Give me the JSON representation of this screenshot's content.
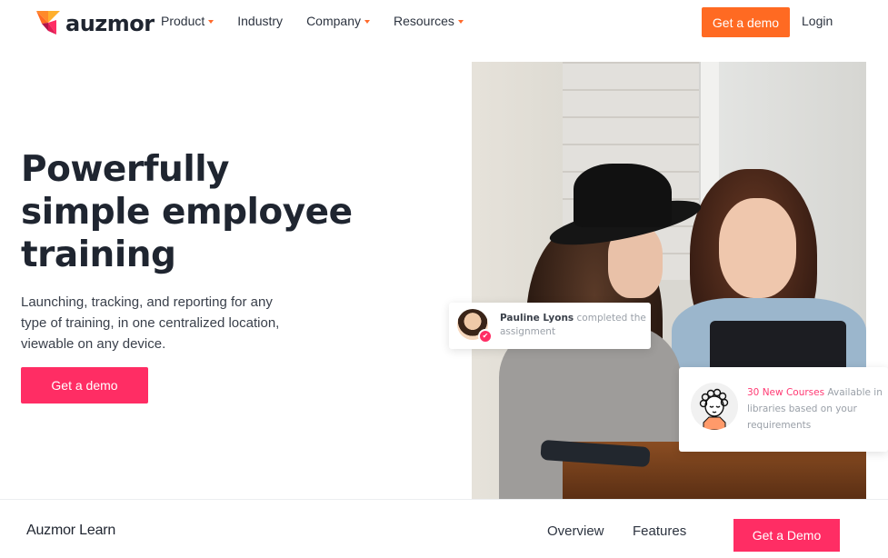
{
  "brand": {
    "name": "auzmor",
    "colors": {
      "orange": "#ff6a22",
      "pink": "#ff2d64",
      "text": "#1f2530"
    }
  },
  "header": {
    "nav": [
      {
        "label": "Product",
        "has_dropdown": true
      },
      {
        "label": "Industry",
        "has_dropdown": false
      },
      {
        "label": "Company",
        "has_dropdown": true
      },
      {
        "label": "Resources",
        "has_dropdown": true
      }
    ],
    "cta_label": "Get a demo",
    "login_label": "Login"
  },
  "hero": {
    "title_lines": [
      "Powerfully",
      "simple employee",
      "training"
    ],
    "subtitle": "Launching, tracking, and reporting for any type of training, in one centralized location, viewable on any device.",
    "cta_label": "Get a demo"
  },
  "cards": {
    "activity": {
      "name": "Pauline Lyons",
      "action": " completed the assignment"
    },
    "courses": {
      "highlight": "30 New Courses",
      "rest": " Available in libraries based on your requirements"
    }
  },
  "subnav": {
    "title": "Auzmor Learn",
    "links": [
      "Overview",
      "Features"
    ],
    "cta_label": "Get a Demo"
  }
}
